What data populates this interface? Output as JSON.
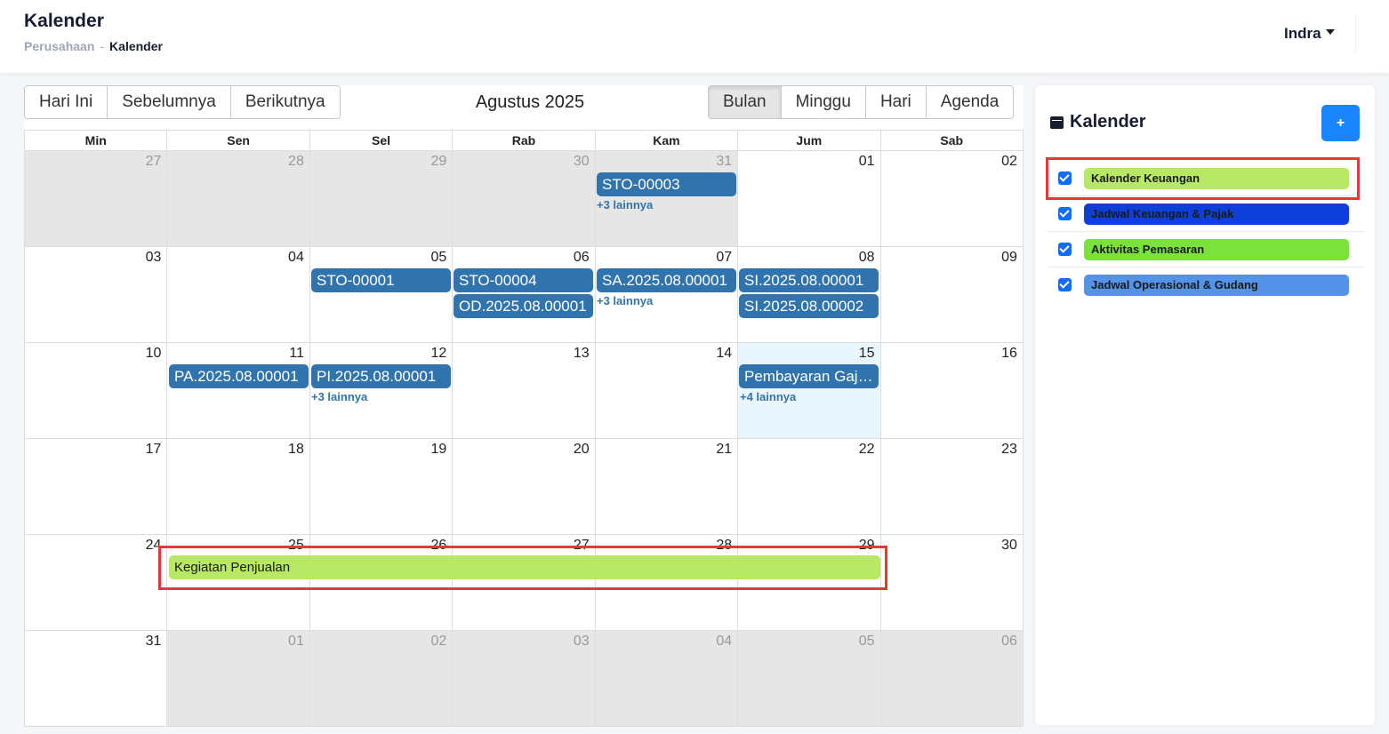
{
  "header": {
    "title": "Kalender",
    "breadcrumb": [
      "Perusahaan",
      "Kalender"
    ],
    "user": "Indra"
  },
  "toolbar": {
    "nav": [
      "Hari Ini",
      "Sebelumnya",
      "Berikutnya"
    ],
    "month_label": "Agustus 2025",
    "views": [
      "Bulan",
      "Minggu",
      "Hari",
      "Agenda"
    ],
    "active_view": "Bulan"
  },
  "calendar": {
    "weekdays": [
      "Min",
      "Sen",
      "Sel",
      "Rab",
      "Kam",
      "Jum",
      "Sab"
    ],
    "weeks": [
      [
        "27",
        "28",
        "29",
        "30",
        "31",
        "01",
        "02"
      ],
      [
        "03",
        "04",
        "05",
        "06",
        "07",
        "08",
        "09"
      ],
      [
        "10",
        "11",
        "12",
        "13",
        "14",
        "15",
        "16"
      ],
      [
        "17",
        "18",
        "19",
        "20",
        "21",
        "22",
        "23"
      ],
      [
        "24",
        "25",
        "26",
        "27",
        "28",
        "29",
        "30"
      ],
      [
        "31",
        "01",
        "02",
        "03",
        "04",
        "05",
        "06"
      ]
    ],
    "today": "15",
    "events": [
      {
        "title": "STO-00003"
      },
      {
        "title": "STO-00001"
      },
      {
        "title": "STO-00004"
      },
      {
        "title": "OD.2025.08.00001"
      },
      {
        "title": "SA.2025.08.00001"
      },
      {
        "title": "SI.2025.08.00001"
      },
      {
        "title": "SI.2025.08.00002"
      },
      {
        "title": "PA.2025.08.00001"
      },
      {
        "title": "PI.2025.08.00001"
      },
      {
        "title": "Pembayaran Gaji ..."
      },
      {
        "title": "Kegiatan Penjualan",
        "color": "#b8e864"
      }
    ],
    "more_links": [
      "+3 lainnya",
      "+3 lainnya",
      "+3 lainnya",
      "+4 lainnya"
    ]
  },
  "sidebar": {
    "title": "Kalender",
    "add_label": "+",
    "calendars": [
      {
        "name": "Kalender Keuangan",
        "color": "#b8e864",
        "checked": true
      },
      {
        "name": "Jadwal Keuangan & Pajak",
        "color": "#0f3fd9",
        "checked": true
      },
      {
        "name": "Aktivitas Pemasaran",
        "color": "#7ae23a",
        "checked": true
      },
      {
        "name": "Jadwal Operasional & Gudang",
        "color": "#5593e8",
        "checked": true
      }
    ]
  },
  "colors": {
    "event_default": "#3174ad",
    "primary_button": "#1b84ff",
    "highlight": "#e53935"
  }
}
